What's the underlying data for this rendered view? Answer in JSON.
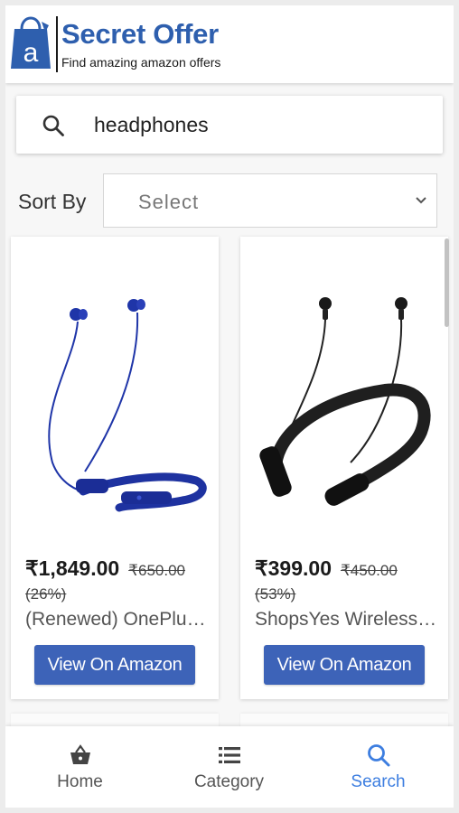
{
  "header": {
    "logo_title": "Secret Offer",
    "logo_tagline": "Find amazing amazon offers",
    "brand_color": "#2e5fae"
  },
  "search": {
    "value": "headphones",
    "icon": "search-icon"
  },
  "sort": {
    "label": "Sort By",
    "selected": "Select"
  },
  "products": [
    {
      "price": "₹1,849.00",
      "mrp": "₹650.00",
      "discount": "(26%)",
      "title": "(Renewed) OnePlus Bullets Wireless Z",
      "button_label": "View On Amazon",
      "image": "blue neckband earphones"
    },
    {
      "price": "₹399.00",
      "mrp": "₹450.00",
      "discount": "(53%)",
      "title": "ShopsYes Wireless Neckband Earphones",
      "button_label": "View On Amazon",
      "image": "black neckband earphones"
    }
  ],
  "bottom_nav": {
    "items": [
      {
        "label": "Home",
        "icon": "basket-icon",
        "active": false
      },
      {
        "label": "Category",
        "icon": "list-icon",
        "active": false
      },
      {
        "label": "Search",
        "icon": "search-icon",
        "active": true
      }
    ]
  },
  "colors": {
    "accent": "#3d63b8",
    "active_nav": "#3d7ee0"
  }
}
